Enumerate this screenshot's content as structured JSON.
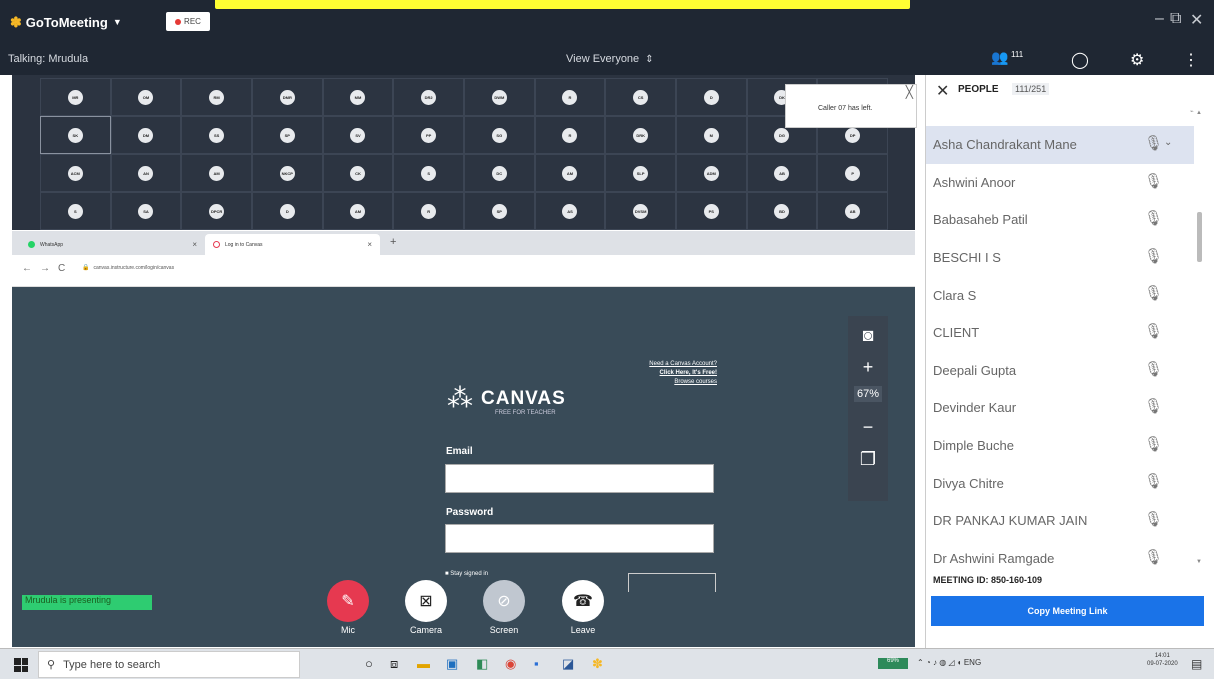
{
  "app": {
    "name": "GoToMeeting",
    "rec_label": "REC"
  },
  "toolbar": {
    "talking": "Talking: Mrudula",
    "view": "View Everyone",
    "people_count": "111"
  },
  "grid": {
    "tiles": [
      [
        "MR",
        "OM",
        "RM",
        "DMR",
        "MM",
        "DR2",
        "DWM",
        "R",
        "CS",
        "D",
        "DK",
        ""
      ],
      [
        "SK",
        "DM",
        "SS",
        "SP",
        "SV",
        "PP",
        "SG",
        "R",
        "DRK",
        "M",
        "DG",
        "DP"
      ],
      [
        "ACM",
        "AN",
        "AM",
        "NKCP",
        "CK",
        "S",
        "DC",
        "AM",
        "SLP",
        "ADM",
        "AB",
        "P"
      ],
      [
        "S",
        "SA",
        "DPCR",
        "D",
        "AM",
        "R",
        "SP",
        "AS",
        "DVSM",
        "PS",
        "BD",
        "AB"
      ]
    ],
    "selected_row": 1,
    "selected_col": 0
  },
  "toast": {
    "message": "Caller 07 has left."
  },
  "browser": {
    "tab1": "WhatsApp",
    "tab2": "Log in to Canvas",
    "url": "canvas.instructure.com/login/canvas"
  },
  "canvas": {
    "logo": "CANVAS",
    "logo_sub": "FREE FOR TEACHER",
    "link1": "Need a Canvas Account?",
    "link2": "Click Here, It's Free!",
    "link3": "Browse courses",
    "email_label": "Email",
    "password_label": "Password",
    "remember": "Stay signed in"
  },
  "zoom": {
    "percent": "67%"
  },
  "presenting": "Mrudula is presenting",
  "controls": {
    "mic": "Mic",
    "camera": "Camera",
    "screen": "Screen",
    "leave": "Leave"
  },
  "people_panel": {
    "title": "PEOPLE",
    "count": "111/251",
    "people": [
      "Asha Chandrakant Mane",
      "Ashwini Anoor",
      "Babasaheb Patil",
      "BESCHI I S",
      "Clara S",
      "CLIENT",
      "Deepali Gupta",
      "Devinder Kaur",
      "Dimple Buche",
      "Divya Chitre",
      "DR PANKAJ KUMAR JAIN",
      "Dr Ashwini Ramgade"
    ],
    "meeting_id": "MEETING ID: 850-160-109",
    "copy_button": "Copy Meeting Link"
  },
  "taskbar": {
    "search": "Type here to search",
    "lang": "ENG",
    "time": "14:01",
    "date": "09-07-2020",
    "battery": "69%"
  },
  "colors": {
    "accent": "#1a73e8",
    "mic_red": "#e63950",
    "presenting_green": "#2ecc71"
  }
}
